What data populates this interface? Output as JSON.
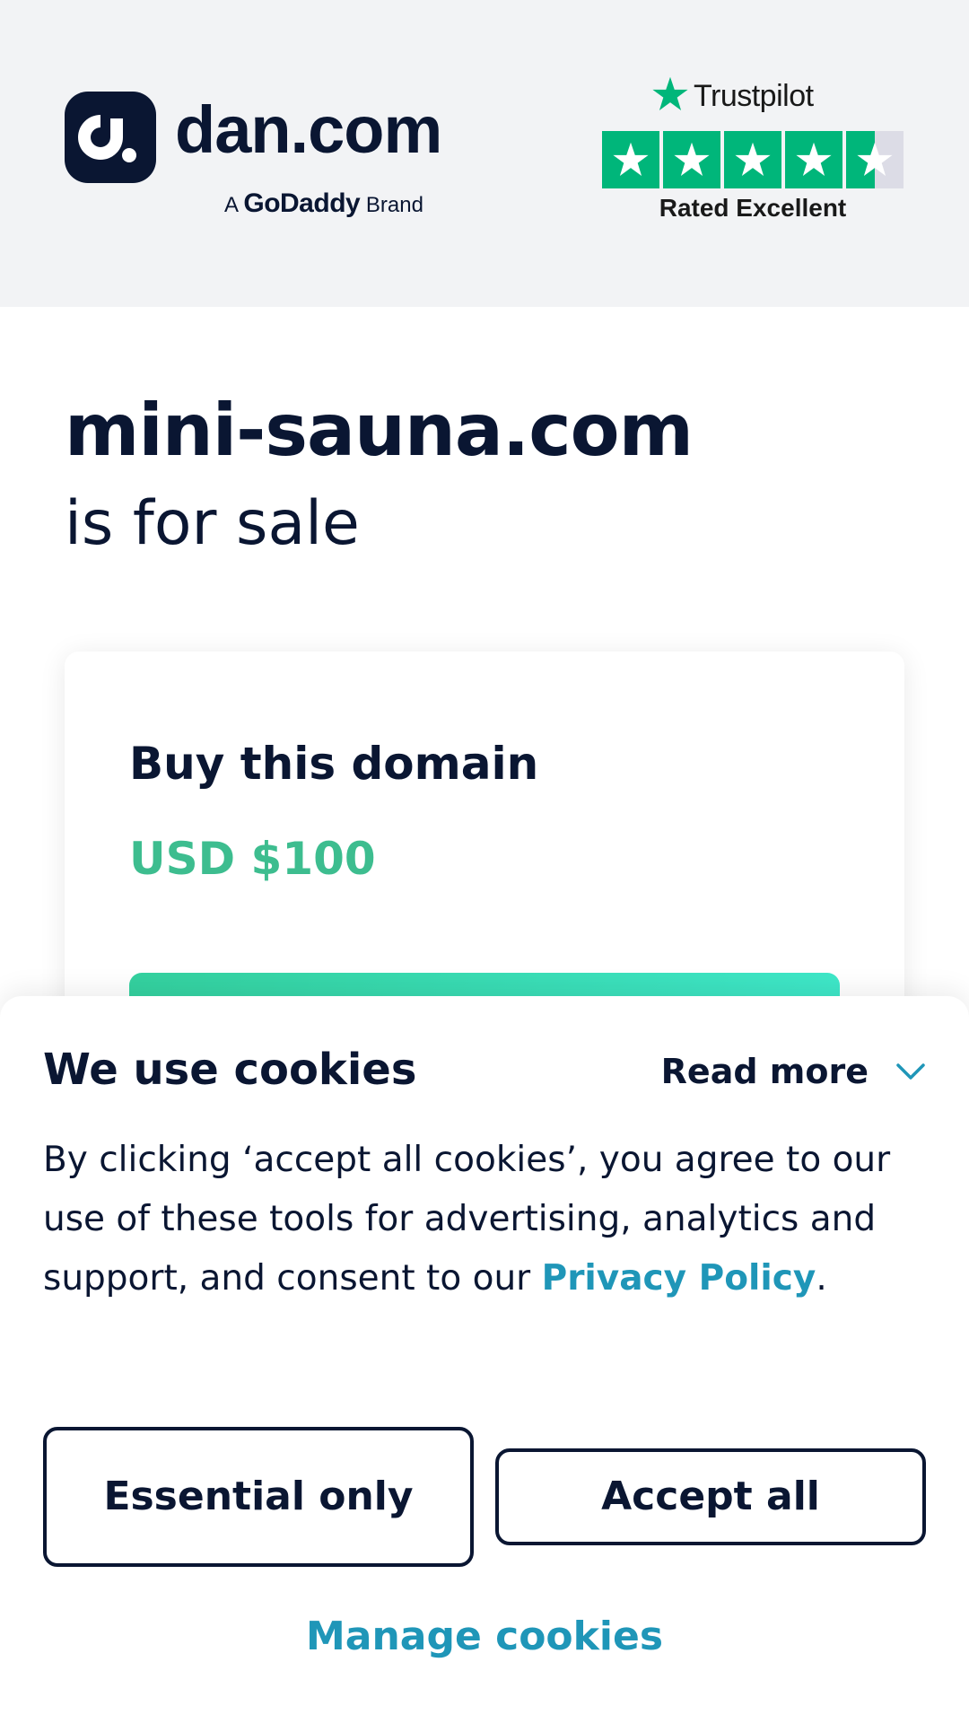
{
  "colors": {
    "navy": "#0a1632",
    "header_bg": "#f2f3f5",
    "trustpilot_green": "#00b67a",
    "price_green": "#3dbd8f",
    "link_teal": "#1f96b8",
    "cta_gradient_start": "#34d19f",
    "cta_gradient_end": "#3ee7c8"
  },
  "header": {
    "logo_icon": "dan-logo-icon",
    "logo_text": "dan.com",
    "brand_prefix": "A",
    "brand_name": "GoDaddy",
    "brand_suffix": "Brand",
    "trustpilot": {
      "icon": "star-icon",
      "name": "Trustpilot",
      "rating_stars": 4.5,
      "rating_label": "Rated Excellent"
    }
  },
  "domain": {
    "name": "mini-sauna.com",
    "status": "is for sale"
  },
  "buy_card": {
    "title": "Buy this domain",
    "price": "USD $100"
  },
  "cookie_banner": {
    "title": "We use cookies",
    "read_more": "Read more",
    "read_more_icon": "chevron-down-icon",
    "body_text": "By clicking ‘accept all cookies’, you agree to our use of these tools for advertising, analytics and support, and consent to our ",
    "privacy_link": "Privacy Policy",
    "body_end": ".",
    "essential_only": "Essential only",
    "accept_all": "Accept all",
    "manage_cookies": "Manage cookies"
  }
}
